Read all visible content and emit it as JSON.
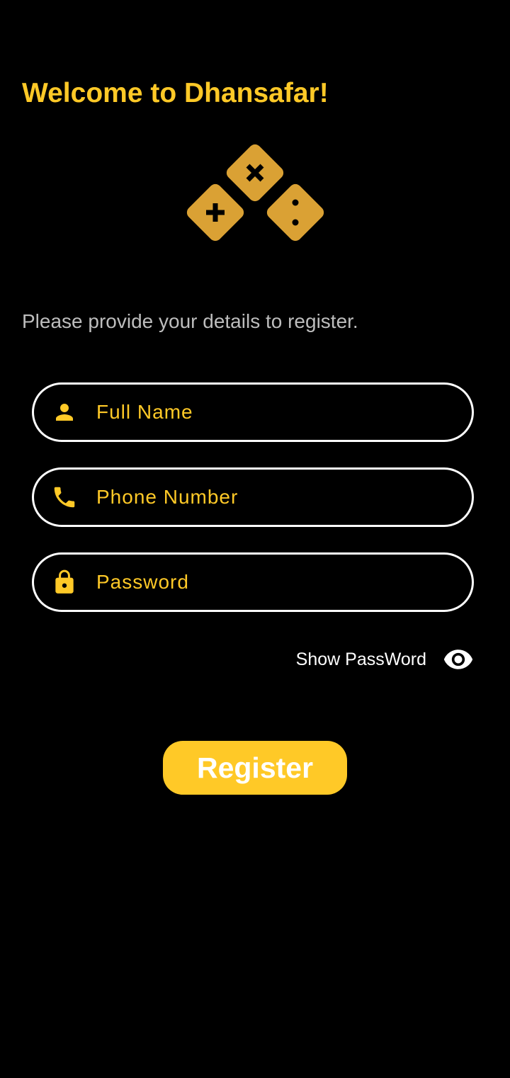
{
  "colors": {
    "background": "#000000",
    "accent": "#FFC927",
    "logo": "#DAA134",
    "muted_text": "#BDBDBD",
    "border": "#FFFFFF",
    "button_text": "#FFFFFF"
  },
  "header": {
    "title": "Welcome to Dhansafar!"
  },
  "logo": {
    "icon": "math-operators-logo"
  },
  "form": {
    "subtitle": "Please provide your details to register.",
    "full_name": {
      "icon": "person-icon",
      "placeholder": "Full Name",
      "value": ""
    },
    "phone": {
      "icon": "phone-icon",
      "placeholder": "Phone Number",
      "value": ""
    },
    "password": {
      "icon": "lock-icon",
      "placeholder": "Password",
      "value": ""
    },
    "show_password": {
      "label": "Show PassWord",
      "icon": "eye-icon"
    },
    "register_label": "Register"
  }
}
